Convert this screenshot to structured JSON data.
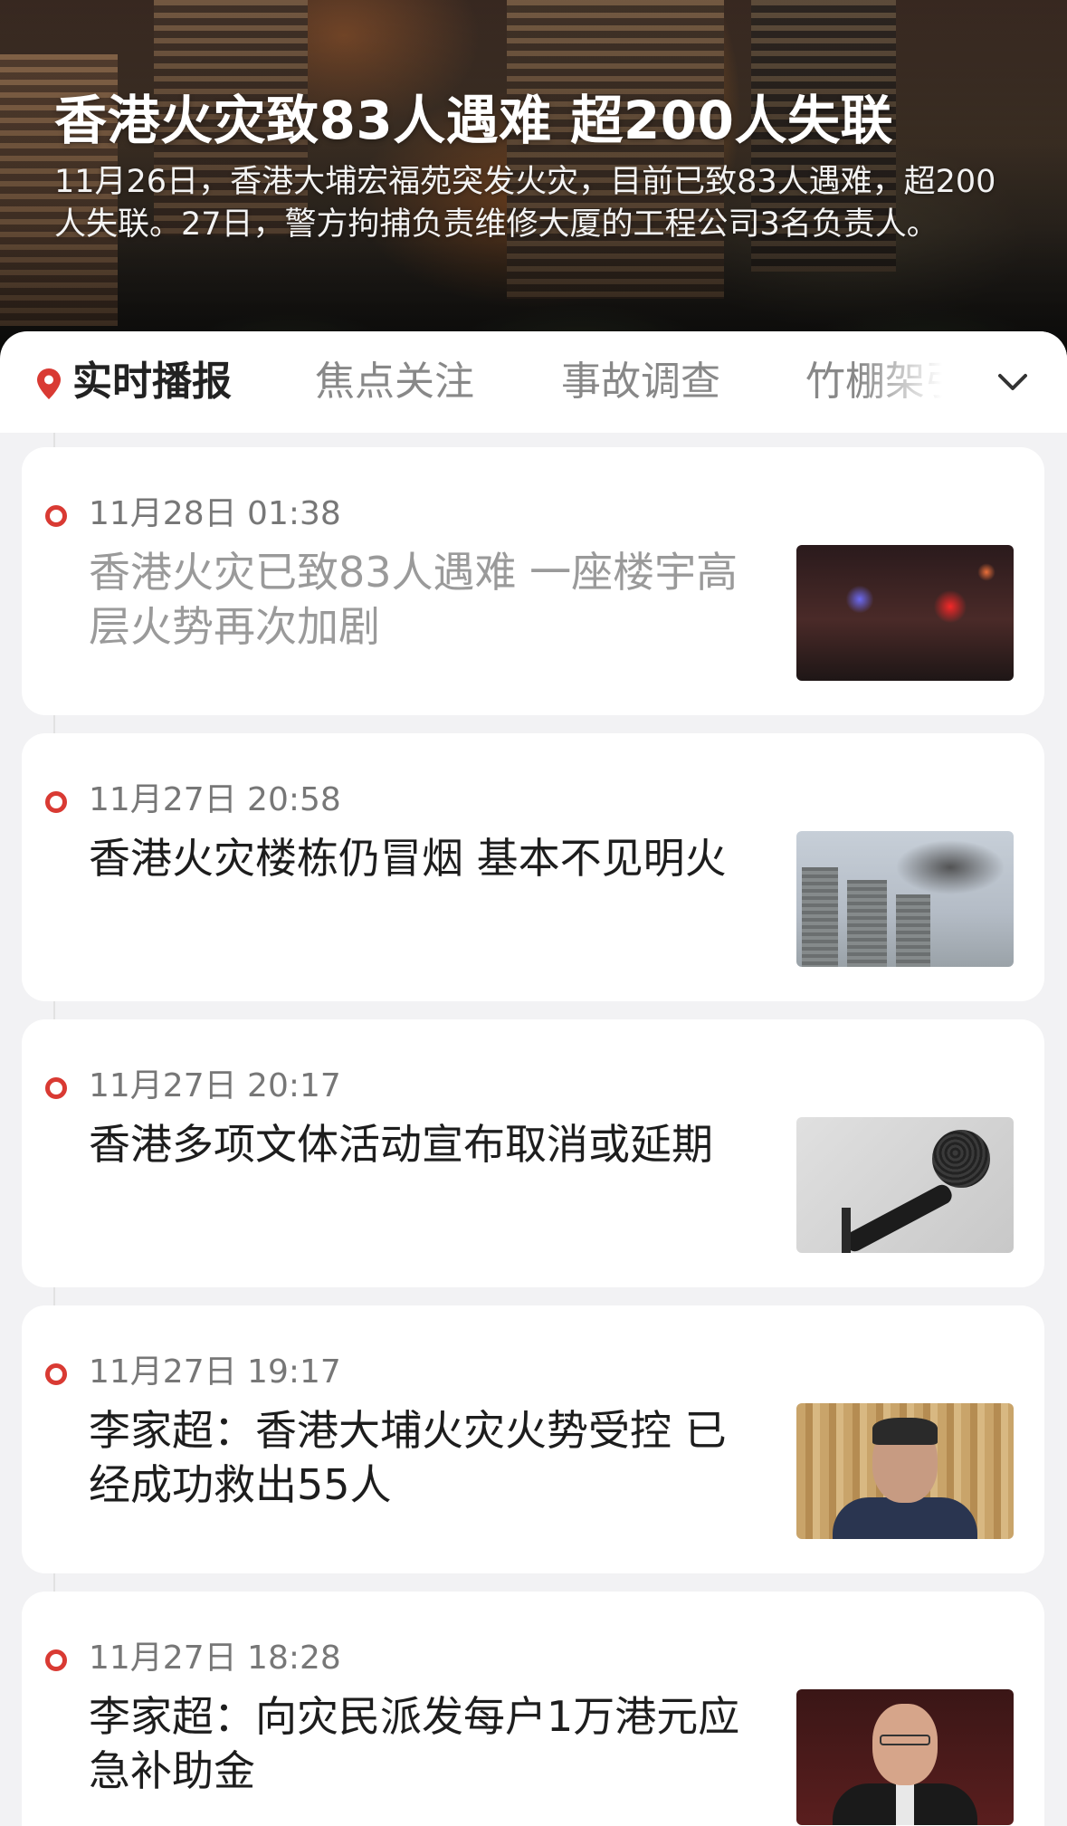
{
  "hero": {
    "title": "香港火灾致83人遇难 超200人失联",
    "description": "11月26日，香港大埔宏福苑突发火灾，目前已致83人遇难，超200人失联。27日，警方拘捕负责维修大厦的工程公司3名负责人。"
  },
  "tabs": [
    {
      "label": "实时播报",
      "active": true,
      "icon": "location-pin-icon"
    },
    {
      "label": "焦点关注",
      "active": false
    },
    {
      "label": "事故调查",
      "active": false
    },
    {
      "label": "竹棚架引",
      "active": false
    }
  ],
  "tab_more_icon": "chevron-down-icon",
  "accent_color": "#d93a33",
  "feed": [
    {
      "time": "11月28日 01:38",
      "headline": "香港火灾已致83人遇难 一座楼宇高层火势再次加剧",
      "read": true,
      "thumbnail": "night-fire-scene"
    },
    {
      "time": "11月27日 20:58",
      "headline": "香港火灾楼栋仍冒烟 基本不见明火",
      "read": false,
      "thumbnail": "smoking-towers"
    },
    {
      "time": "11月27日 20:17",
      "headline": "香港多项文体活动宣布取消或延期",
      "read": false,
      "thumbnail": "microphone"
    },
    {
      "time": "11月27日 19:17",
      "headline": "李家超：香港大埔火灾火势受控 已经成功救出55人",
      "read": false,
      "thumbnail": "speaker-portrait"
    },
    {
      "time": "11月27日 18:28",
      "headline": "李家超：向灾民派发每户1万港元应急补助金",
      "read": false,
      "thumbnail": "speaker-portrait-2"
    }
  ]
}
